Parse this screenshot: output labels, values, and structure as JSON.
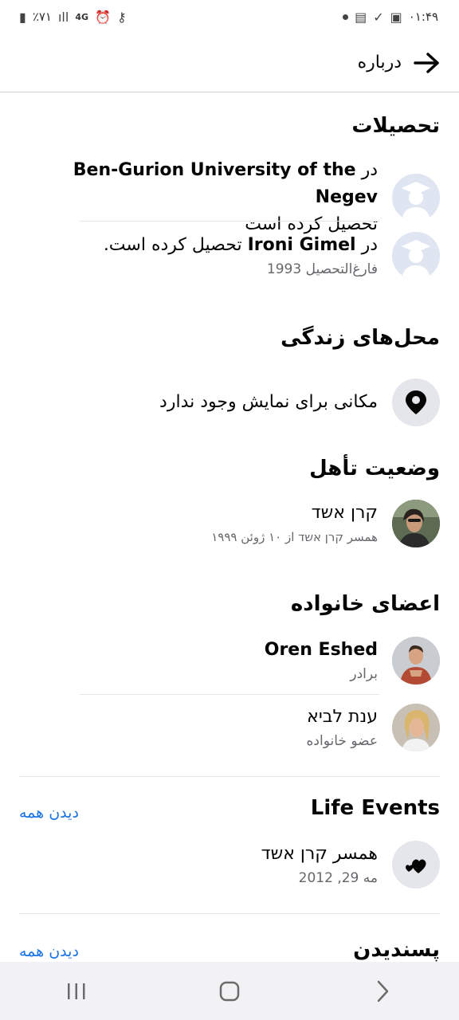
{
  "status_bar": {
    "time": "۰۱:۴۹",
    "battery": "٪۷۱",
    "network": "4G"
  },
  "header": {
    "title": "درباره"
  },
  "education": {
    "title": "تحصیلات",
    "items": [
      {
        "prefix": "در",
        "school": "Ben-Gurion University of the Negev",
        "suffix": "تحصیل کرده است",
        "detail": ""
      },
      {
        "prefix": "در",
        "school": "Ironi Gimel",
        "suffix": "تحصیل کرده است.",
        "detail": "فارغ‌التحصیل 1993"
      }
    ]
  },
  "places": {
    "title": "محل‌های زندگی",
    "empty_text": "مکانی برای نمایش وجود ندارد"
  },
  "relationship": {
    "title": "وضعیت تأهل",
    "name": "קרן אשד",
    "detail": "همسر קרן אשד از ۱۰ ژوئن ۱۹۹۹"
  },
  "family": {
    "title": "اعضای خانواده",
    "members": [
      {
        "name": "Oren Eshed",
        "relation": "برادر"
      },
      {
        "name": "ענת לביא",
        "relation": "عضو خانواده"
      }
    ]
  },
  "life_events": {
    "title": "Life Events",
    "see_all": "دیدن همه",
    "event_title": "همسر קרן אשד",
    "event_date": "مه 29, 2012"
  },
  "likes": {
    "title": "پسندیدن",
    "see_all": "دیدن همه"
  },
  "colors": {
    "link": "#1b74e4",
    "secondary_text": "#65676b",
    "divider": "#e4e6eb"
  }
}
